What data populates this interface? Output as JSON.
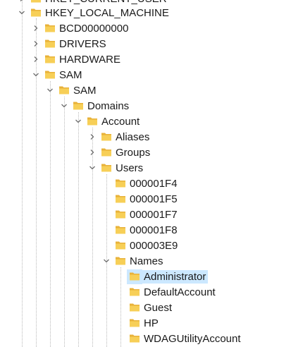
{
  "tree": {
    "clipped_top_label": "HKEY_CURRENT_USER",
    "root": {
      "label": "HKEY_LOCAL_MACHINE",
      "expanded": true
    },
    "nodes": [
      {
        "label": "BCD00000000",
        "level": 1,
        "expander": "collapsed"
      },
      {
        "label": "DRIVERS",
        "level": 1,
        "expander": "collapsed"
      },
      {
        "label": "HARDWARE",
        "level": 1,
        "expander": "collapsed"
      },
      {
        "label": "SAM",
        "level": 1,
        "expander": "expanded"
      },
      {
        "label": "SAM",
        "level": 2,
        "expander": "expanded"
      },
      {
        "label": "Domains",
        "level": 3,
        "expander": "expanded"
      },
      {
        "label": "Account",
        "level": 4,
        "expander": "expanded"
      },
      {
        "label": "Aliases",
        "level": 5,
        "expander": "collapsed"
      },
      {
        "label": "Groups",
        "level": 5,
        "expander": "collapsed"
      },
      {
        "label": "Users",
        "level": 5,
        "expander": "expanded"
      },
      {
        "label": "000001F4",
        "level": 6,
        "expander": "none"
      },
      {
        "label": "000001F5",
        "level": 6,
        "expander": "none"
      },
      {
        "label": "000001F7",
        "level": 6,
        "expander": "none"
      },
      {
        "label": "000001F8",
        "level": 6,
        "expander": "none"
      },
      {
        "label": "000003E9",
        "level": 6,
        "expander": "none"
      },
      {
        "label": "Names",
        "level": 6,
        "expander": "expanded"
      },
      {
        "label": "Administrator",
        "level": 7,
        "expander": "none",
        "selected": true
      },
      {
        "label": "DefaultAccount",
        "level": 7,
        "expander": "none"
      },
      {
        "label": "Guest",
        "level": 7,
        "expander": "none"
      },
      {
        "label": "HP",
        "level": 7,
        "expander": "none"
      },
      {
        "label": "WDAGUtilityAccount",
        "level": 7,
        "expander": "none"
      }
    ],
    "icons": {
      "folder": "folder-icon",
      "collapsed": "chevron-right-icon",
      "expanded": "chevron-down-icon"
    },
    "colors": {
      "folder_back": "#e8b23a",
      "folder_front": "#f7cf57",
      "selection": "#cce8ff",
      "chevron": "#6e6e6e",
      "guide": "#b9b9b9",
      "text": "#1a1a1a"
    }
  }
}
